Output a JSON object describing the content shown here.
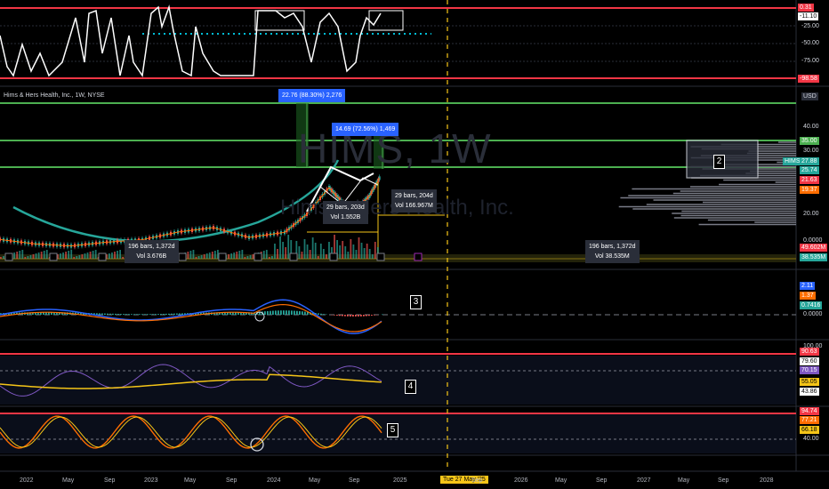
{
  "header": {
    "title": "Hims & Hers Health, Inc., 1W, NYSE",
    "currency": "USD"
  },
  "watermark": {
    "symbol": "HIMS, 1W",
    "name": "Hims & Hers Health, Inc."
  },
  "pane_labels": [
    "2",
    "3",
    "4",
    "5"
  ],
  "rsi_top_axis": {
    "ticks": [
      "-25.00",
      "-50.00",
      "-75.00"
    ],
    "tags": [
      {
        "text": "0.31",
        "color": "#f23645"
      },
      {
        "text": "-11.10",
        "color": "#000000",
        "bg": "#ffffff"
      },
      {
        "text": "-98.58",
        "color": "#f23645"
      }
    ]
  },
  "price_axis": {
    "ticks": [
      "40.00",
      "30.00",
      "20.00",
      "10.00",
      "0.0000"
    ],
    "tags": [
      {
        "text": "35.00",
        "bg": "#4caf50"
      },
      {
        "text": "27.88",
        "bg": "#26a69a"
      },
      {
        "text": "25.74",
        "bg": "#26a69a"
      },
      {
        "text": "21.63",
        "bg": "#f23645"
      },
      {
        "text": "19.37",
        "bg": "#ff6d00"
      },
      {
        "text": "49.602M",
        "bg": "#f23645"
      },
      {
        "text": "38.535M",
        "bg": "#26a69a"
      }
    ],
    "ticker_tag": "HIMS"
  },
  "macd_axis": {
    "tags": [
      {
        "text": "2.11",
        "bg": "#2962ff"
      },
      {
        "text": "1.37",
        "bg": "#ff6d00"
      },
      {
        "text": "0.7416",
        "bg": "#26a69a"
      }
    ],
    "zero": "0.0000"
  },
  "rsi_axis": {
    "top": "100.00",
    "tags": [
      {
        "text": "90.63",
        "bg": "#f23645"
      },
      {
        "text": "79.60",
        "bg": "#ffffff"
      },
      {
        "text": "70.15",
        "bg": "#7e57c2"
      },
      {
        "text": "55.05",
        "bg": "#f5c518"
      },
      {
        "text": "43.86",
        "bg": "#ffffff"
      }
    ]
  },
  "stoch_axis": {
    "tags": [
      {
        "text": "94.74",
        "bg": "#f23645"
      },
      {
        "text": "77.21",
        "bg": "#ff6d00"
      },
      {
        "text": "66.18",
        "bg": "#f5c518"
      }
    ],
    "bottom": "40.00"
  },
  "callouts": [
    {
      "id": "measure-1",
      "lines": [
        "22.76 (88.30%) 2,276"
      ],
      "blue": true
    },
    {
      "id": "measure-2",
      "lines": [
        "14.69 (72.56%) 1,469"
      ],
      "blue": true
    },
    {
      "id": "range-1",
      "lines": [
        "29 bars, 203d",
        "Vol 1.552B"
      ]
    },
    {
      "id": "range-2",
      "lines": [
        "29 bars, 204d",
        "Vol 166.967M"
      ]
    },
    {
      "id": "range-3",
      "lines": [
        "196 bars, 1,372d",
        "Vol 3.676B"
      ]
    },
    {
      "id": "range-4",
      "lines": [
        "196 bars, 1,372d",
        "Vol 38.535M"
      ]
    }
  ],
  "time_axis": [
    "2022",
    "May",
    "Sep",
    "2023",
    "May",
    "Sep",
    "2024",
    "May",
    "Sep",
    "2025",
    "Tue 27 May '25",
    "Sep",
    "2026",
    "May",
    "Sep",
    "2027",
    "May",
    "Sep",
    "2028"
  ],
  "chart_data": {
    "type": "line",
    "title": "Hims & Hers Health, Inc., 1W, NYSE",
    "price_series": {
      "name": "HIMS",
      "x": [
        "2021-12",
        "2022-03",
        "2022-06",
        "2022-09",
        "2022-12",
        "2023-03",
        "2023-06",
        "2023-09",
        "2023-12",
        "2024-03",
        "2024-06",
        "2024-07",
        "2024-09",
        "2024-10",
        "2024-11"
      ],
      "close": [
        6.5,
        5.0,
        4.3,
        5.6,
        6.4,
        9.0,
        10.5,
        7.2,
        8.9,
        15.0,
        24.0,
        19.0,
        16.5,
        21.0,
        27.88
      ]
    },
    "horizontal_levels": [
      35.0,
      25.74,
      0.0
    ],
    "ylim": [
      0,
      45
    ]
  }
}
